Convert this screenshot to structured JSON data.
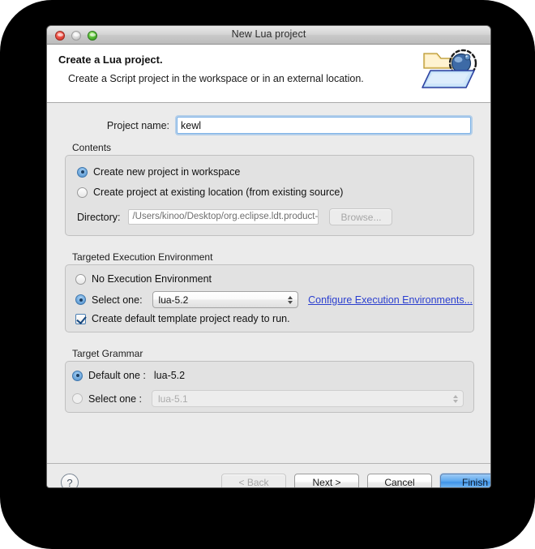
{
  "window": {
    "title": "New Lua project",
    "traffic_lights": [
      "close-button",
      "minimize-button",
      "zoom-button"
    ]
  },
  "header": {
    "title": "Create a Lua project.",
    "subtitle": "Create a Script project in the workspace or in an external location.",
    "icon": "project-folder-icon"
  },
  "form": {
    "project_name_label": "Project name:",
    "project_name_value": "kewl",
    "project_name_placeholder": ""
  },
  "contents": {
    "group_title": "Contents",
    "radio_workspace_label": "Create new project in workspace",
    "radio_workspace_selected": true,
    "radio_existing_label": "Create project at existing location (from existing source)",
    "radio_existing_selected": false,
    "directory_label": "Directory:",
    "directory_value": "/Users/kinoo/Desktop/org.eclipse.ldt.product-macosx.co",
    "browse_label": "Browse..."
  },
  "execution_environment": {
    "group_title": "Targeted Execution Environment",
    "radio_none_label": "No Execution Environment",
    "radio_none_selected": false,
    "radio_select_label": "Select one:",
    "radio_select_selected": true,
    "combo_value": "lua-5.2",
    "configure_link": "Configure Execution Environments...",
    "checkbox_label": "Create default template project ready to run.",
    "checkbox_checked": true
  },
  "target_grammar": {
    "group_title": "Target Grammar",
    "radio_default_label": "Default one :",
    "radio_default_selected": true,
    "default_value": "lua-5.2",
    "radio_select_label": "Select one :",
    "radio_select_selected": false,
    "combo_value": "lua-5.1"
  },
  "footer": {
    "help_label": "?",
    "back_label": "< Back",
    "next_label": "Next >",
    "cancel_label": "Cancel",
    "finish_label": "Finish"
  },
  "colors": {
    "accent": "#3e93e8",
    "link": "#2b3fcf",
    "window_bg": "#ebebeb",
    "group_bg": "#e2e2e2",
    "field_focus": "#7fb4e8"
  }
}
